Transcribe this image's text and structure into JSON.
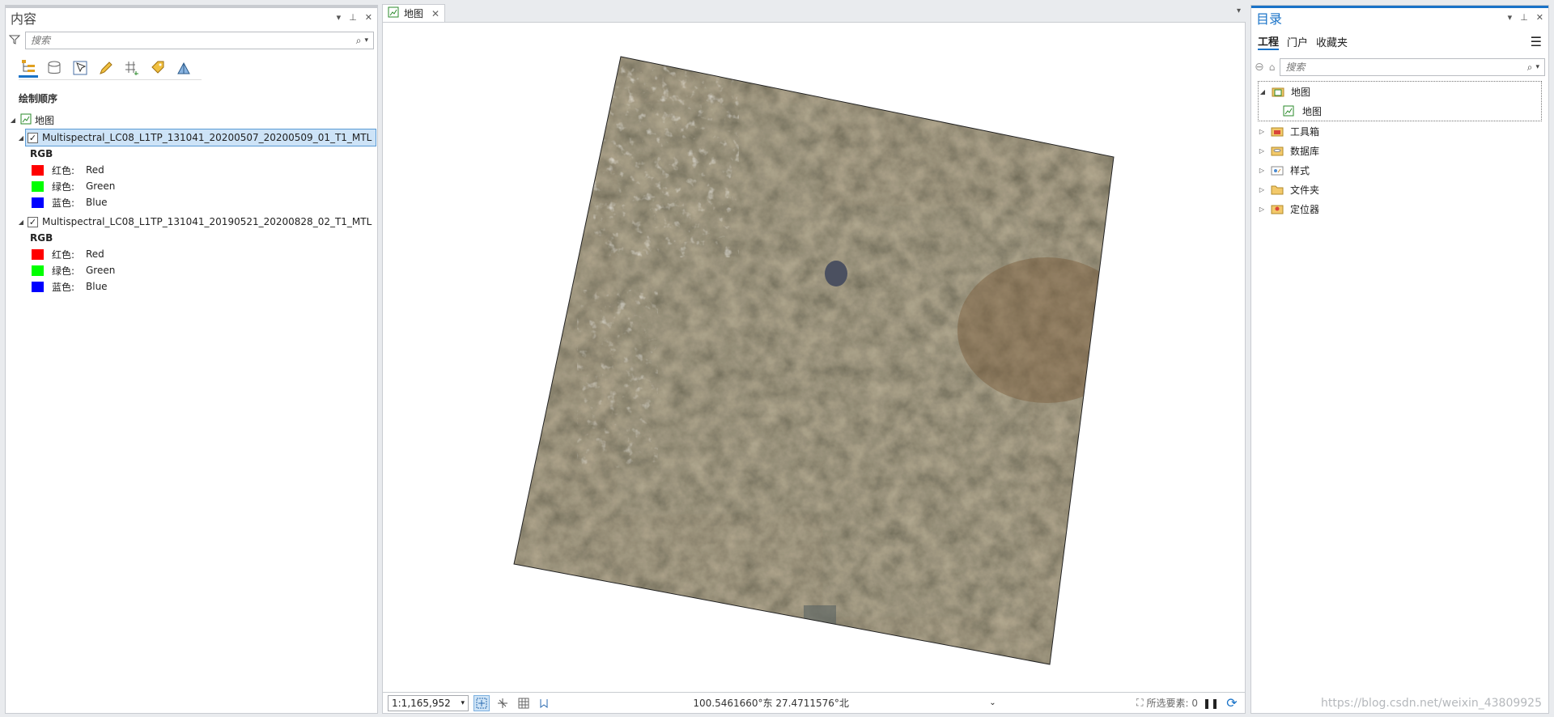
{
  "contents_pane": {
    "title": "内容",
    "search_placeholder": "搜索",
    "section_label": "绘制顺序",
    "map_label": "地图",
    "layers": [
      {
        "name": "Multispectral_LC08_L1TP_131041_20200507_20200509_01_T1_MTL",
        "checked": true,
        "selected": true,
        "legend_title": "RGB",
        "channels": [
          {
            "channel": "红色:",
            "band": "Red",
            "color": "#ff0000"
          },
          {
            "channel": "绿色:",
            "band": "Green",
            "color": "#00ff00"
          },
          {
            "channel": "蓝色:",
            "band": "Blue",
            "color": "#0000ff"
          }
        ]
      },
      {
        "name": "Multispectral_LC08_L1TP_131041_20190521_20200828_02_T1_MTL",
        "checked": true,
        "selected": false,
        "legend_title": "RGB",
        "channels": [
          {
            "channel": "红色:",
            "band": "Red",
            "color": "#ff0000"
          },
          {
            "channel": "绿色:",
            "band": "Green",
            "color": "#00ff00"
          },
          {
            "channel": "蓝色:",
            "band": "Blue",
            "color": "#0000ff"
          }
        ]
      }
    ]
  },
  "map_view": {
    "tab_label": "地图",
    "scale": "1:1,165,952",
    "coordinates": "100.5461660°东 27.4711576°北",
    "selected_features": "所选要素: 0"
  },
  "catalog_pane": {
    "title": "目录",
    "tabs": [
      "工程",
      "门户",
      "收藏夹"
    ],
    "search_placeholder": "搜索",
    "items": [
      {
        "label": "地图",
        "expanded": true,
        "icon": "map-folder-icon"
      },
      {
        "label": "地图",
        "child": true,
        "icon": "map-icon"
      },
      {
        "label": "工具箱",
        "icon": "toolbox-icon"
      },
      {
        "label": "数据库",
        "icon": "database-icon"
      },
      {
        "label": "样式",
        "icon": "style-icon"
      },
      {
        "label": "文件夹",
        "icon": "folder-icon"
      },
      {
        "label": "定位器",
        "icon": "locator-icon"
      }
    ]
  },
  "watermark": "https://blog.csdn.net/weixin_43809925"
}
